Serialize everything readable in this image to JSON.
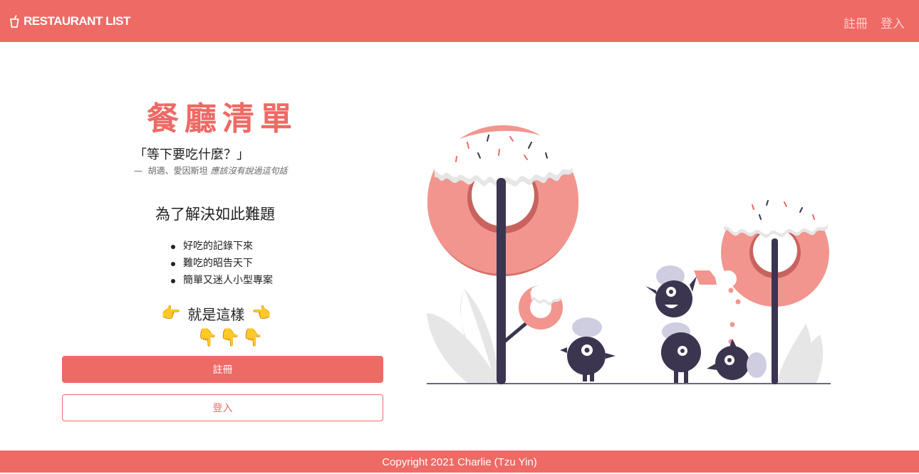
{
  "navbar": {
    "brand": "RESTAURANT LIST",
    "brand_icon": "cup-icon",
    "links": [
      "註冊",
      "登入"
    ]
  },
  "hero": {
    "title": "餐廳清單",
    "quote": "「等下要吃什麼？」",
    "cite_dash": "—",
    "cite_authors": "胡適、愛因斯坦",
    "cite_note": "應該沒有說過這句話",
    "subhead": "為了解決如此難題",
    "features": [
      "好吃的記錄下來",
      "難吃的昭告天下",
      "簡單又迷人小型專案"
    ],
    "this_text": "就是這樣",
    "left_hand": "👉",
    "right_hand": "👈",
    "down_hands": [
      "👇",
      "👇",
      "👇"
    ]
  },
  "buttons": {
    "register": "註冊",
    "login": "登入"
  },
  "footer": {
    "copyright": "Copyright 2021 Charlie (Tzu Yin)"
  },
  "colors": {
    "accent": "#ee6a65",
    "donut": "#f2958f",
    "dark": "#3b3550",
    "lavender": "#cfcde0"
  }
}
